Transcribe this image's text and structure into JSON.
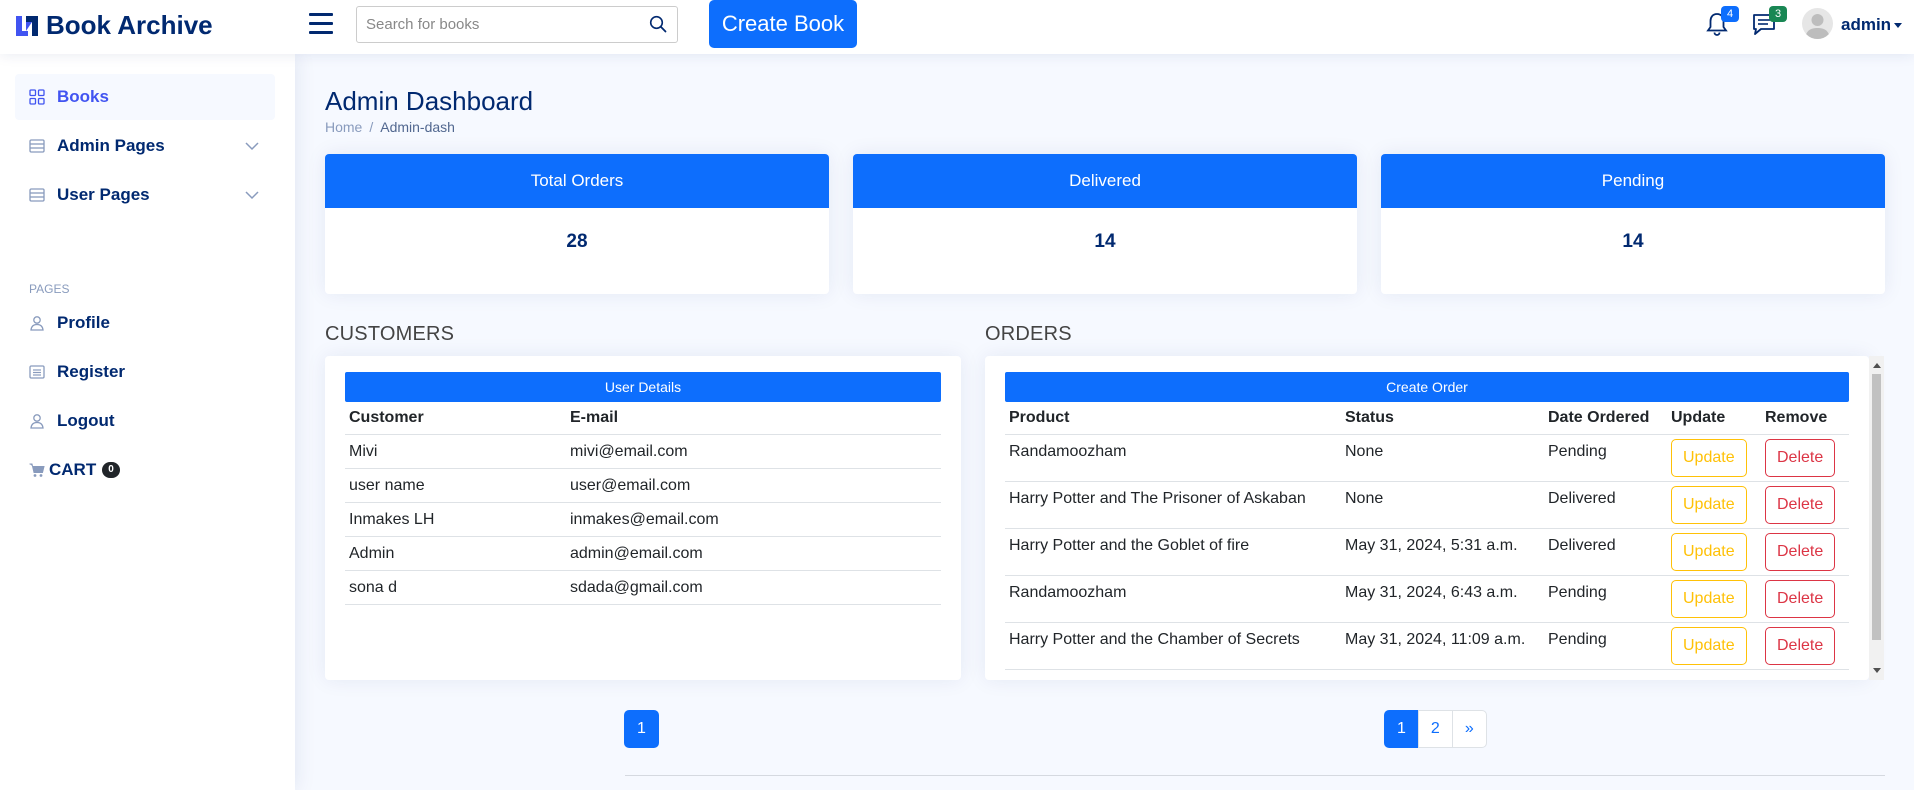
{
  "header": {
    "app_name": "Book Archive",
    "search_placeholder": "Search for books",
    "create_book_label": "Create Book",
    "notifications_count": "4",
    "messages_count": "3",
    "user_name": "admin"
  },
  "sidebar": {
    "items": [
      {
        "label": "Books",
        "icon": "grid-icon"
      },
      {
        "label": "Admin Pages",
        "icon": "layout-icon"
      },
      {
        "label": "User Pages",
        "icon": "layout-icon"
      }
    ],
    "pages_heading": "PAGES",
    "pages": [
      {
        "label": "Profile",
        "icon": "person-icon"
      },
      {
        "label": "Register",
        "icon": "card-list-icon"
      },
      {
        "label": "Logout",
        "icon": "person-icon"
      }
    ],
    "cart_label": "CART",
    "cart_count": "0"
  },
  "main": {
    "title": "Admin Dashboard",
    "breadcrumb": {
      "home": "Home",
      "separator": "/",
      "current": "Admin-dash"
    }
  },
  "stats": [
    {
      "label": "Total Orders",
      "value": "28"
    },
    {
      "label": "Delivered",
      "value": "14"
    },
    {
      "label": "Pending",
      "value": "14"
    }
  ],
  "customers": {
    "section_title": "CUSTOMERS",
    "button_label": "User Details",
    "columns": [
      "Customer",
      "E-mail"
    ],
    "rows": [
      [
        "Mivi",
        "mivi@email.com"
      ],
      [
        "user name",
        "user@email.com"
      ],
      [
        "Inmakes LH",
        "inmakes@email.com"
      ],
      [
        "Admin",
        "admin@email.com"
      ],
      [
        "sona d",
        "sdada@gmail.com"
      ]
    ]
  },
  "orders": {
    "section_title": "ORDERS",
    "button_label": "Create Order",
    "columns": [
      "Product",
      "Status",
      "Date Ordered",
      "Update",
      "Remove"
    ],
    "update_label": "Update",
    "delete_label": "Delete",
    "rows": [
      [
        "Randamoozham",
        "None",
        "Pending"
      ],
      [
        "Harry Potter and The Prisoner of Askaban",
        "None",
        "Delivered"
      ],
      [
        "Harry Potter and the Goblet of fire",
        "May 31, 2024, 5:31 a.m.",
        "Delivered"
      ],
      [
        "Randamoozham",
        "May 31, 2024, 6:43 a.m.",
        "Pending"
      ],
      [
        "Harry Potter and the Chamber of Secrets",
        "May 31, 2024, 11:09 a.m.",
        "Pending"
      ]
    ]
  },
  "pagination": {
    "customers_pages": [
      "1"
    ],
    "orders_pages": [
      "1",
      "2"
    ],
    "next_label": "»"
  },
  "colors": {
    "primary": "#0d6efd",
    "navy": "#012970",
    "warning": "#ffc107",
    "danger": "#dc3545",
    "success": "#198754"
  }
}
